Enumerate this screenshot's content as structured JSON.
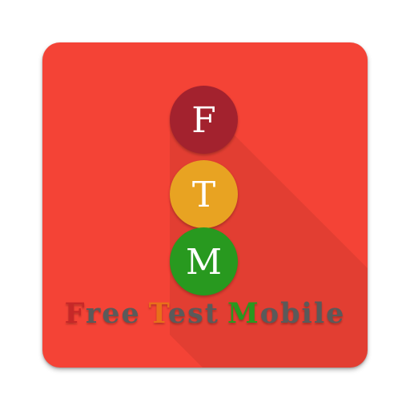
{
  "logo": {
    "colors": {
      "background": "#f44336",
      "f_circle": "#a3222e",
      "t_circle": "#e8a322",
      "m_circle": "#28991f",
      "title_text": "#5a5a5a",
      "f_initial": "#c62828",
      "t_initial": "#e8701a",
      "m_initial": "#28991f"
    },
    "circles": [
      {
        "letter": "F"
      },
      {
        "letter": "T"
      },
      {
        "letter": "M"
      }
    ],
    "title": {
      "words": [
        {
          "initial": "F",
          "rest": "ree"
        },
        {
          "initial": "T",
          "rest": "est"
        },
        {
          "initial": "M",
          "rest": "obile"
        }
      ]
    }
  }
}
